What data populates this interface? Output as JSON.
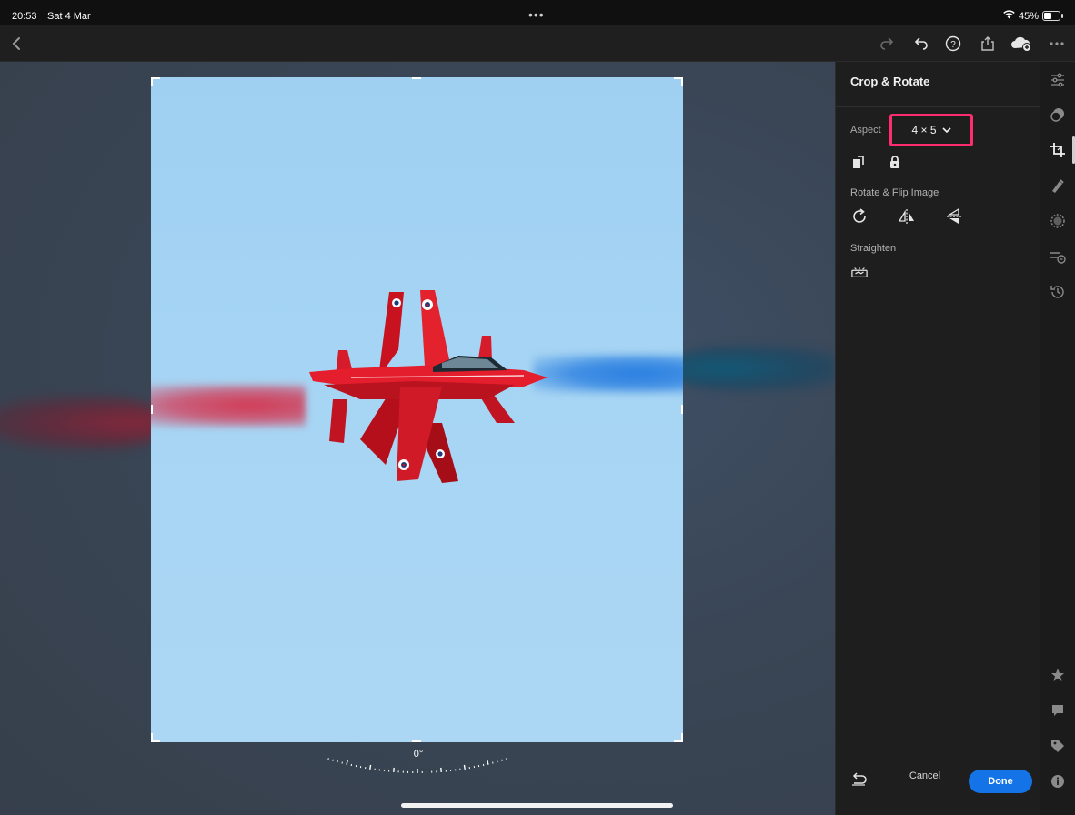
{
  "status_bar": {
    "time": "20:53",
    "date": "Sat 4 Mar",
    "battery": "45%"
  },
  "toolbar": {
    "icons": [
      "back-icon",
      "redo-icon",
      "undo-icon",
      "help-icon",
      "share-icon",
      "cloud-sync-icon",
      "more-icon"
    ]
  },
  "canvas": {
    "angle": "0°"
  },
  "panel": {
    "title": "Crop & Rotate",
    "aspect_label": "Aspect",
    "aspect_value": "4 × 5",
    "rotate_flip_label": "Rotate & Flip Image",
    "straighten_label": "Straighten",
    "cancel_label": "Cancel",
    "done_label": "Done"
  },
  "colors": {
    "accent": "#1473e6",
    "highlight": "#ff2d6f",
    "sky": "#a7d5f4",
    "jet": "#e0202f"
  },
  "rail": {
    "icons": [
      "edit-sliders-icon",
      "presets-icon",
      "crop-icon",
      "healing-icon",
      "masking-icon",
      "versions-icon",
      "history-icon",
      "rating-star-icon",
      "comment-icon",
      "tag-icon",
      "info-icon"
    ],
    "active": "crop-icon"
  }
}
